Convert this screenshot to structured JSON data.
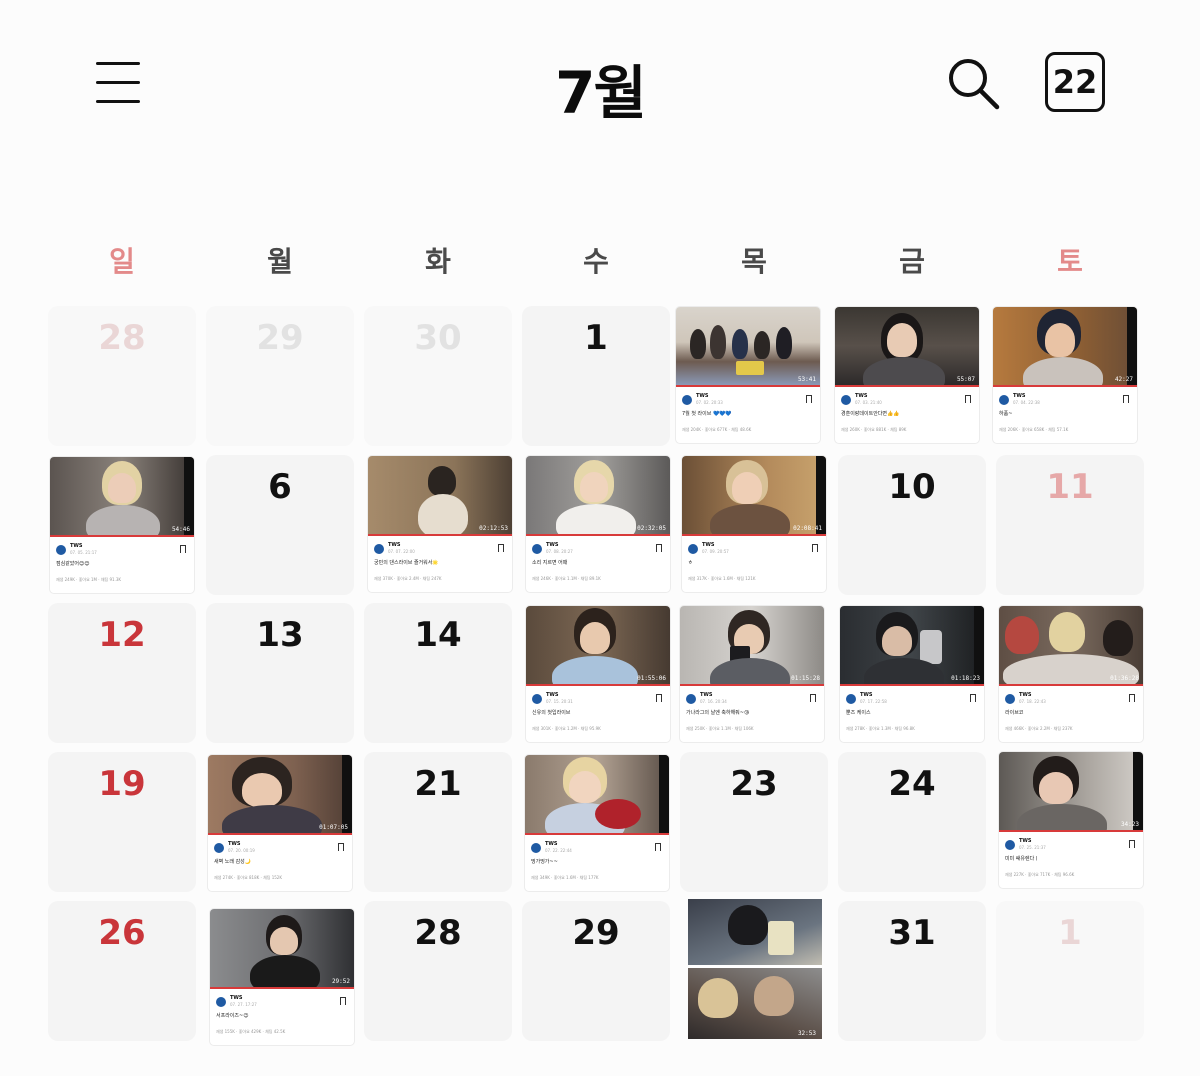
{
  "header": {
    "month_title": "7월",
    "today_label": "22"
  },
  "weekdays": [
    "일",
    "월",
    "화",
    "수",
    "목",
    "금",
    "토"
  ],
  "days": {
    "d28a": "28",
    "d29a": "29",
    "d30a": "30",
    "d1": "1",
    "d6": "6",
    "d10": "10",
    "d11": "11",
    "d12": "12",
    "d13": "13",
    "d14": "14",
    "d19": "19",
    "d21": "21",
    "d23": "23",
    "d24": "24",
    "d26": "26",
    "d28": "28",
    "d29": "29",
    "d31": "31",
    "d1b": "1"
  },
  "posts": [
    {
      "id": "p2",
      "name": "TWS",
      "date": "07. 02. 20:33",
      "caption": "7월 첫 라이브 💙💙💙",
      "stats": "재생 204K · 좋아요 677K · 채팅 48.6K",
      "duration": "53:41"
    },
    {
      "id": "p3",
      "name": "TWS",
      "date": "07. 03. 21:40",
      "caption": "경훈이랑데이트안다면👍👍",
      "stats": "재생 260K · 좋아요 881K · 채팅 89K",
      "duration": "55:07"
    },
    {
      "id": "p4",
      "name": "TWS",
      "date": "07. 04. 22:38",
      "caption": "하품~",
      "stats": "재생 206K · 좋아요 658K · 채팅 57.1K",
      "duration": "42:27"
    },
    {
      "id": "p5",
      "name": "TWS",
      "date": "07. 05. 21:17",
      "caption": "점심같았어😊😊",
      "stats": "재생 249K · 좋아요 1M · 채팅 91.3K",
      "duration": "54:46"
    },
    {
      "id": "p7",
      "name": "TWS",
      "date": "07. 07. 22:00",
      "caption": "궁민의 댄스라이브 즐거워서🌟",
      "stats": "재생 370K · 좋아요 2.4M · 채팅 247K",
      "duration": "02:12:53"
    },
    {
      "id": "p8",
      "name": "TWS",
      "date": "07. 08. 20:27",
      "caption": "소리 지르면 어때",
      "stats": "재생 246K · 좋아요 1.1M · 채팅 89.1K",
      "duration": "02:32:05"
    },
    {
      "id": "p9",
      "name": "TWS",
      "date": "07. 09. 20:57",
      "caption": "ㅎ",
      "stats": "재생 317K · 좋아요 1.6M · 채팅 121K",
      "duration": "02:08:41"
    },
    {
      "id": "p15",
      "name": "TWS",
      "date": "07. 15. 20:31",
      "caption": "신유의 첫입라이브",
      "stats": "재생 301K · 좋아요 1.2M · 채팅 95.9K",
      "duration": "01:55:06"
    },
    {
      "id": "p16",
      "name": "TWS",
      "date": "07. 16. 20:34",
      "caption": "가나라그의 날엔 축하해줘~😘",
      "stats": "재생 250K · 좋아요 1.1M · 채팅 106K",
      "duration": "01:15:28"
    },
    {
      "id": "p17",
      "name": "TWS",
      "date": "07. 17. 22:58",
      "caption": "뿐즈 케이스",
      "stats": "재생 278K · 좋아요 1.3M · 채팅 96.8K",
      "duration": "01:18:23"
    },
    {
      "id": "p18",
      "name": "TWS",
      "date": "07. 18. 22:43",
      "caption": "라이브코",
      "stats": "재생 466K · 좋아요 2.2M · 채팅 237K",
      "duration": "01:36:28"
    },
    {
      "id": "p20",
      "name": "TWS",
      "date": "07. 20. 00:19",
      "caption": "새벽 노래 감성🌙",
      "stats": "재생 274K · 좋아요 818K · 채팅 152K",
      "duration": "01:07:05"
    },
    {
      "id": "p22",
      "name": "TWS",
      "date": "07. 22. 22:44",
      "caption": "띵가띵가~~",
      "stats": "재생 349K · 좋아요 1.6M · 채팅 177K",
      "duration": ""
    },
    {
      "id": "p25",
      "name": "TWS",
      "date": "07. 25. 21:37",
      "caption": "미미 쌔유렌다ㅣ",
      "stats": "재생 227K · 좋아요 717K · 채팅 96.6K",
      "duration": "34:23"
    },
    {
      "id": "p27",
      "name": "TWS",
      "date": "07. 27. 17:27",
      "caption": "서프라이즈~😉",
      "stats": "재생 155K · 좋아요 429K · 채팅 42.5K",
      "duration": "29:52"
    }
  ],
  "double_post": {
    "duration": "32:53"
  }
}
